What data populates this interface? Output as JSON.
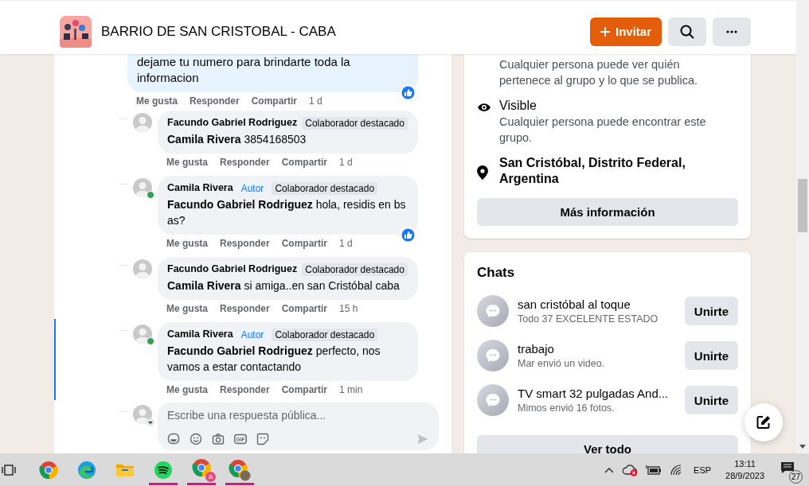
{
  "header": {
    "group_name": "BARRIO DE SAN CRISTOBAL - CABA",
    "buttons": [
      {
        "kind": "invite",
        "label": "Invitar"
      },
      {
        "kind": "search"
      },
      {
        "kind": "more"
      }
    ]
  },
  "top_reply": {
    "text": "dejame tu numero para brindarte toda la informacion",
    "liked": true,
    "actions": [
      "Me gusta",
      "Responder",
      "Compartir"
    ],
    "time": "1 d"
  },
  "comments": [
    {
      "author": "Facundo Gabriel Rodriguez",
      "online": false,
      "badges": [
        {
          "kind": "contributor",
          "label": "Colaborador destacado"
        }
      ],
      "text": "**Camila Rivera** 3854168503",
      "liked": false,
      "highlighted": false,
      "actions": [
        "Me gusta",
        "Responder",
        "Compartir"
      ],
      "time": "1 d"
    },
    {
      "author": "Camila Rivera",
      "online": true,
      "badges": [
        {
          "kind": "author",
          "label": "Autor"
        },
        {
          "kind": "contributor",
          "label": "Colaborador destacado"
        }
      ],
      "text": "**Facundo Gabriel Rodriguez** hola, residis en bs as?",
      "liked": true,
      "highlighted": false,
      "actions": [
        "Me gusta",
        "Responder",
        "Compartir"
      ],
      "time": "1 d"
    },
    {
      "author": "Facundo Gabriel Rodriguez",
      "online": false,
      "badges": [
        {
          "kind": "contributor",
          "label": "Colaborador destacado"
        }
      ],
      "text": "**Camila Rivera** si amiga..en san Cristóbal caba",
      "liked": false,
      "highlighted": false,
      "actions": [
        "Me gusta",
        "Responder",
        "Compartir"
      ],
      "time": "15 h"
    },
    {
      "author": "Camila Rivera",
      "online": true,
      "badges": [
        {
          "kind": "author",
          "label": "Autor"
        },
        {
          "kind": "contributor",
          "label": "Colaborador destacado"
        }
      ],
      "text": "**Facundo Gabriel Rodriguez** perfecto, nos vamos a estar contactando",
      "liked": false,
      "highlighted": true,
      "actions": [
        "Me gusta",
        "Responder",
        "Compartir"
      ],
      "time": "1 min"
    }
  ],
  "reply_box": {
    "placeholder": "Escribe una respuesta pública...",
    "gif_label": "GIF"
  },
  "about": {
    "partial_description": "Cualquier persona puede ver quién pertenece al grupo y lo que se publica.",
    "items": [
      {
        "kind": "visibility",
        "title": "Visible",
        "description": "Cualquier persona puede encontrar este grupo."
      },
      {
        "kind": "location",
        "title": "San Cristóbal, Distrito Federal, Argentina"
      }
    ],
    "button": "Más información"
  },
  "chats": {
    "title": "Chats",
    "items": [
      {
        "name": "san cristóbal al toque",
        "last_message": "Todo 37 EXCELENTE ESTADO",
        "button": "Unirte"
      },
      {
        "name": "trabajo",
        "last_message": "Mar envió un video.",
        "button": "Unirte"
      },
      {
        "name": "TV smart 32 pulgadas And...",
        "last_message": "Mimos envió 16 fotos.",
        "button": "Unirte"
      }
    ],
    "see_all": "Ver todo"
  },
  "taskbar": {
    "apps": [
      {
        "kind": "taskview",
        "open": false
      },
      {
        "kind": "chrome",
        "open": false
      },
      {
        "kind": "edge",
        "open": false
      },
      {
        "kind": "folder",
        "open": false
      },
      {
        "kind": "spotify",
        "open": true
      },
      {
        "kind": "chrome-letter",
        "badge": "a",
        "open": true
      },
      {
        "kind": "chrome-photo",
        "open": true
      }
    ],
    "language": "ESP",
    "time": "13:11",
    "date": "28/9/2023",
    "notifications": "27"
  }
}
